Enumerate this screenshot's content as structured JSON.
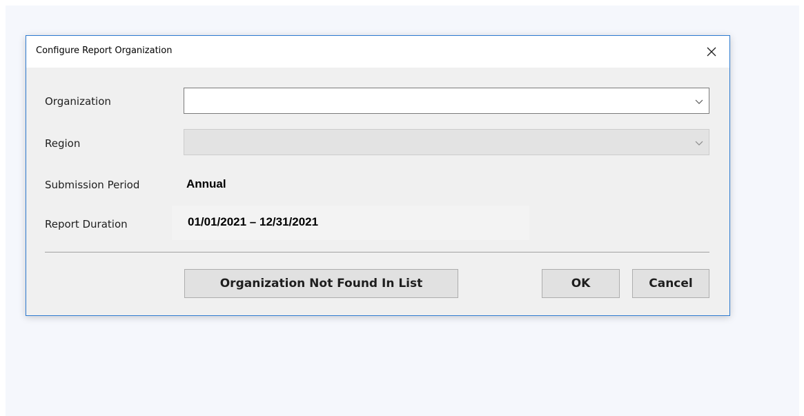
{
  "dialog": {
    "title": "Configure Report Organization",
    "fields": {
      "organization_label": "Organization",
      "organization_value": "",
      "region_label": "Region",
      "region_value": "",
      "period_label": "Submission Period",
      "period_value": "Annual",
      "duration_label": "Report Duration",
      "duration_value": "01/01/2021 – 12/31/2021"
    },
    "buttons": {
      "not_found": "Organization Not Found In List",
      "ok": "OK",
      "cancel": "Cancel"
    }
  },
  "icons": {
    "close": "close-icon",
    "dropdown": "chevron-down-icon"
  },
  "colors": {
    "accent_border": "#2b79d0",
    "dialog_bg": "#f0f0f0",
    "button_bg": "#e1e1e1",
    "disabled_field_bg": "#e3e3e3"
  }
}
